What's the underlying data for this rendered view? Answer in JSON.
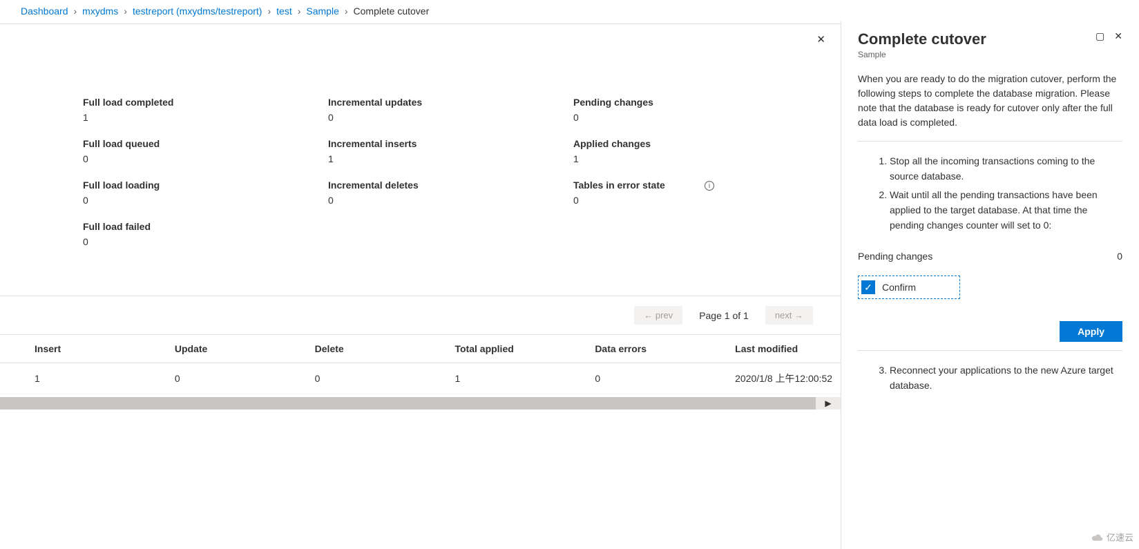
{
  "breadcrumb": {
    "items": [
      "Dashboard",
      "mxydms",
      "testreport (mxydms/testreport)",
      "test",
      "Sample"
    ],
    "current": "Complete cutover"
  },
  "stats": [
    {
      "label": "Full load completed",
      "value": "1"
    },
    {
      "label": "Incremental updates",
      "value": "0"
    },
    {
      "label": "Pending changes",
      "value": "0"
    },
    {
      "label": "Full load queued",
      "value": "0"
    },
    {
      "label": "Incremental inserts",
      "value": "1"
    },
    {
      "label": "Applied changes",
      "value": "1"
    },
    {
      "label": "Full load loading",
      "value": "0"
    },
    {
      "label": "Incremental deletes",
      "value": "0"
    },
    {
      "label": "Tables in error state",
      "value": "0",
      "info": true
    },
    {
      "label": "Full load failed",
      "value": "0"
    }
  ],
  "pager": {
    "prev": "← prev",
    "label": "Page 1 of 1",
    "next": "next →"
  },
  "table": {
    "headers": [
      "Insert",
      "Update",
      "Delete",
      "Total applied",
      "Data errors",
      "Last modified"
    ],
    "rows": [
      [
        "1",
        "0",
        "0",
        "1",
        "0",
        "2020/1/8 上午12:00:52"
      ]
    ]
  },
  "panel": {
    "title": "Complete cutover",
    "subtitle": "Sample",
    "intro": "When you are ready to do the migration cutover, perform the following steps to complete the database migration. Please note that the database is ready for cutover only after the full data load is completed.",
    "steps12": [
      "Stop all the incoming transactions coming to the source database.",
      "Wait until all the pending transactions have been applied to the target database. At that time the pending changes counter will set to 0:"
    ],
    "pending_label": "Pending changes",
    "pending_value": "0",
    "confirm_label": "Confirm",
    "apply_label": "Apply",
    "step3": "Reconnect your applications to the new Azure target database."
  },
  "watermark": "亿速云"
}
